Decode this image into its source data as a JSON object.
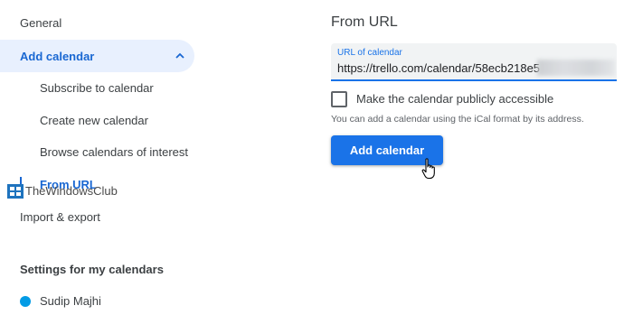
{
  "sidebar": {
    "general": "General",
    "add_calendar": "Add calendar",
    "subitems": [
      "Subscribe to calendar",
      "Create new calendar",
      "Browse calendars of interest",
      "From URL"
    ],
    "import_export": "Import & export",
    "settings_title": "Settings for my calendars",
    "calendar_name": "Sudip Majhi",
    "calendar_color": "#039be5"
  },
  "main": {
    "title": "From URL",
    "url_label": "URL of calendar",
    "url_value": "https://trello.com/calendar/58ecb218e5",
    "checkbox_label": "Make the calendar publicly accessible",
    "checkbox_checked": false,
    "helper_text": "You can add a calendar using the iCal format by its address.",
    "add_button": "Add calendar"
  },
  "watermark": {
    "text": "TheWindowsClub"
  },
  "colors": {
    "accent": "#1a73e8",
    "active_bg": "#e8f0fe",
    "active_text": "#1967d2"
  },
  "icons": {
    "chevron": "chevron-up-icon",
    "cursor": "hand-pointer-icon"
  }
}
